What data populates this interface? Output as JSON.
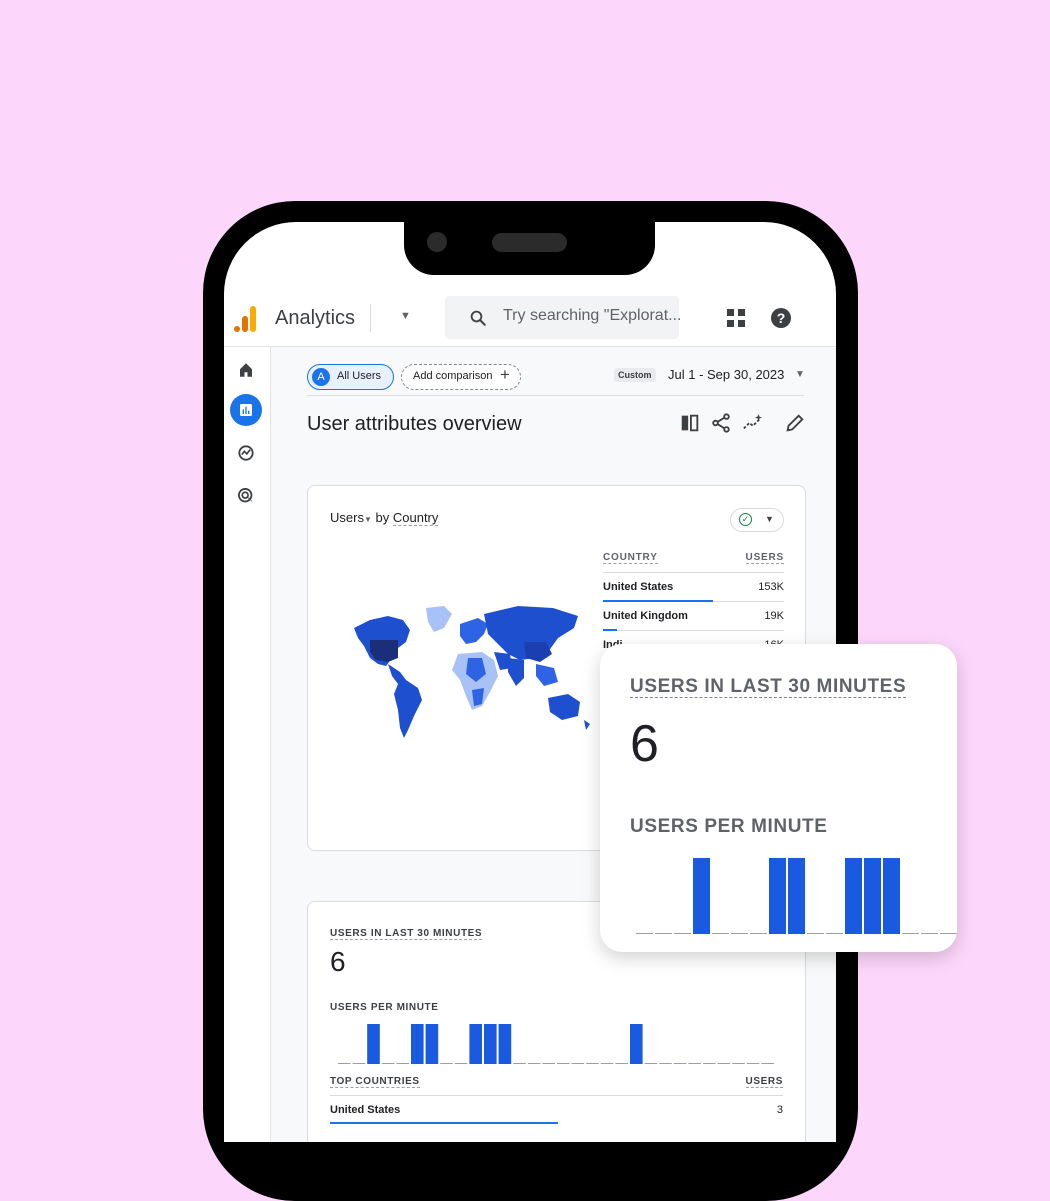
{
  "header": {
    "app_title": "Analytics",
    "search_placeholder": "Try searching \"Explorat..."
  },
  "rail": {
    "items": [
      "home-icon",
      "reports-icon",
      "explore-icon",
      "advertising-icon"
    ],
    "active_index": 1
  },
  "toolbar": {
    "segment_letter": "A",
    "segment_label": "All Users",
    "add_comparison_label": "Add comparison",
    "add_comparison_icon": "+",
    "date_badge": "Custom",
    "date_range": "Jul 1 - Sep 30, 2023"
  },
  "page": {
    "title": "User attributes overview"
  },
  "country_card": {
    "metric": "Users",
    "by_label": "by",
    "dimension": "Country",
    "col_country": "COUNTRY",
    "col_users": "USERS",
    "rows": [
      {
        "country": "United States",
        "users": "153K",
        "share": 0.61
      },
      {
        "country": "United Kingdom",
        "users": "19K",
        "share": 0.08
      },
      {
        "country": "Indi",
        "users": "16K",
        "share": 0.06
      }
    ]
  },
  "realtime_card": {
    "title": "USERS IN LAST 30 MINUTES",
    "value": "6",
    "per_minute_label": "USERS PER MINUTE",
    "top_countries_label": "TOP COUNTRIES",
    "users_col": "USERS",
    "top_country": "United States",
    "top_country_users": "3"
  },
  "floating_card": {
    "title": "USERS IN LAST 30 MINUTES",
    "value": "6",
    "per_minute_label": "USERS PER MINUTE"
  },
  "chart_data": [
    {
      "type": "bar",
      "title": "USERS PER MINUTE",
      "categories": [
        "1",
        "2",
        "3",
        "4",
        "5",
        "6",
        "7",
        "8",
        "9",
        "10",
        "11",
        "12",
        "13",
        "14",
        "15",
        "16",
        "17",
        "18",
        "19",
        "20",
        "21",
        "22",
        "23",
        "24",
        "25",
        "26",
        "27",
        "28",
        "29",
        "30"
      ],
      "values": [
        0,
        0,
        1,
        0,
        0,
        1,
        1,
        0,
        0,
        1,
        1,
        1,
        0,
        0,
        0,
        0,
        0,
        0,
        0,
        0,
        1,
        0,
        0,
        0,
        0,
        0,
        0,
        0,
        0,
        0
      ]
    },
    {
      "type": "bar",
      "title": "USERS PER MINUTE",
      "categories": [
        "1",
        "2",
        "3",
        "4",
        "5",
        "6",
        "7",
        "8",
        "9",
        "10",
        "11",
        "12",
        "13",
        "14",
        "15",
        "16",
        "17"
      ],
      "values": [
        0,
        0,
        0,
        1,
        0,
        0,
        0,
        1,
        1,
        0,
        0,
        1,
        1,
        1,
        0,
        0,
        0
      ]
    }
  ],
  "colors": {
    "background": "#fdd6fb",
    "accent": "#1a73e8",
    "bar": "#1a5ae0"
  }
}
